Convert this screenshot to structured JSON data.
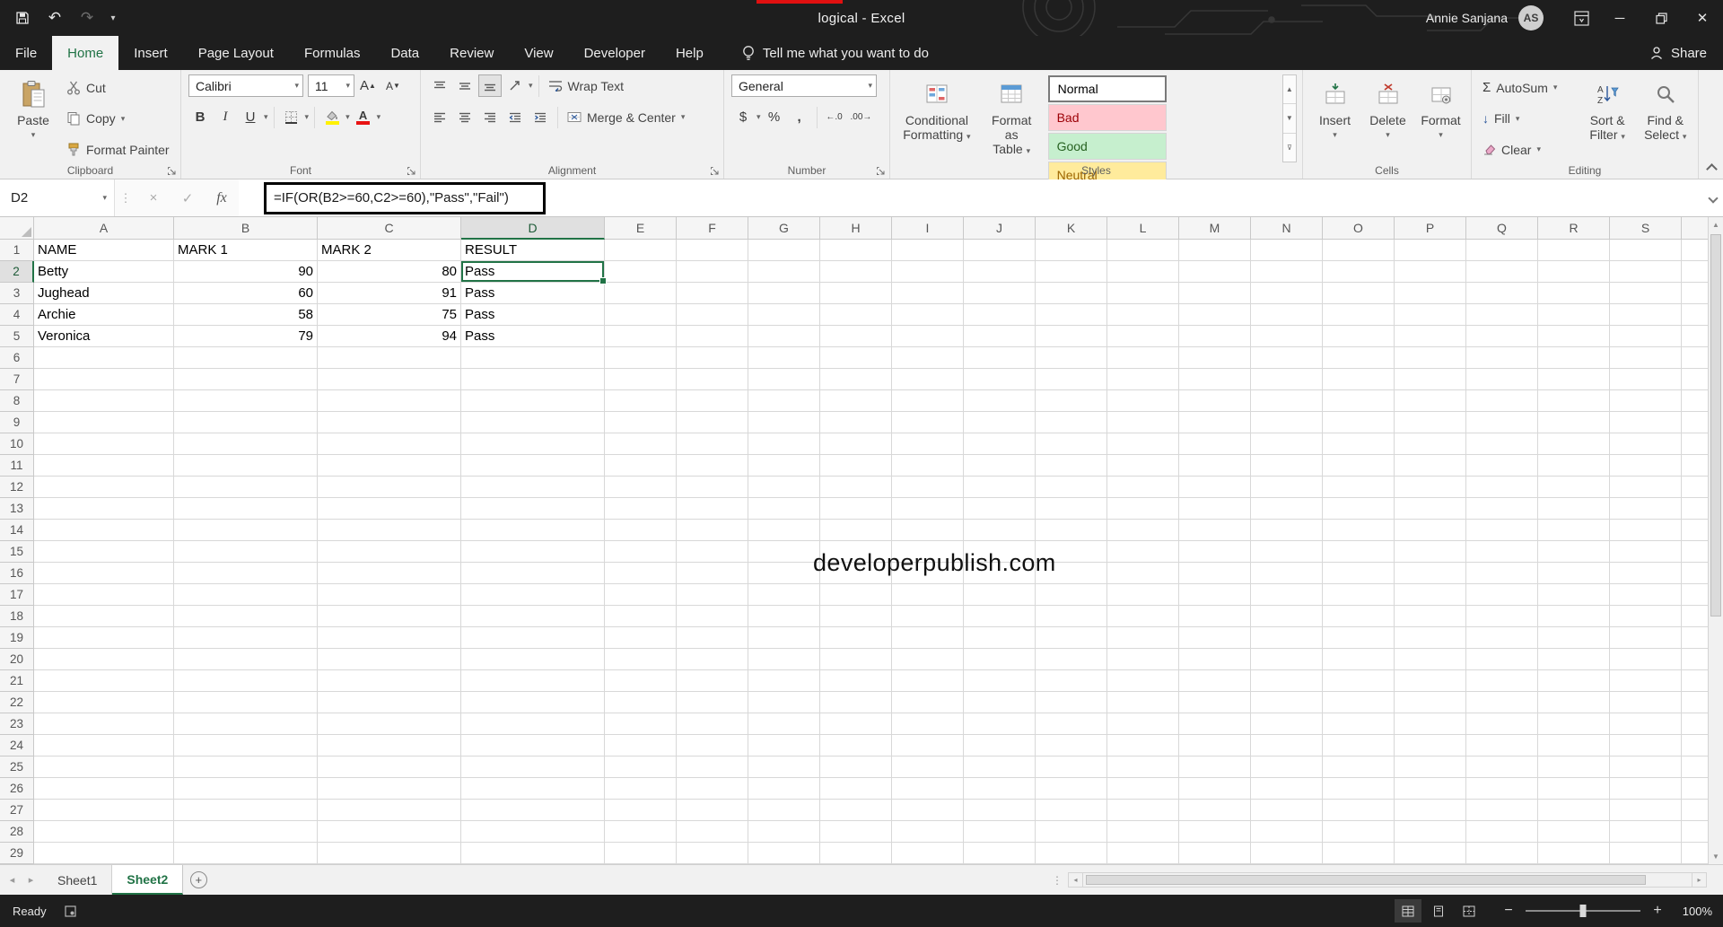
{
  "title_bar": {
    "title": "logical  -  Excel",
    "user_name": "Annie Sanjana",
    "user_initials": "AS"
  },
  "ribbon_tabs": {
    "items": [
      {
        "label": "File"
      },
      {
        "label": "Home"
      },
      {
        "label": "Insert"
      },
      {
        "label": "Page Layout"
      },
      {
        "label": "Formulas"
      },
      {
        "label": "Data"
      },
      {
        "label": "Review"
      },
      {
        "label": "View"
      },
      {
        "label": "Developer"
      },
      {
        "label": "Help"
      }
    ],
    "active": "Home",
    "tell_me": "Tell me what you want to do",
    "share": "Share"
  },
  "ribbon": {
    "clipboard": {
      "label": "Clipboard",
      "paste": "Paste",
      "cut": "Cut",
      "copy": "Copy",
      "format_painter": "Format Painter"
    },
    "font": {
      "label": "Font",
      "family": "Calibri",
      "size": "11"
    },
    "alignment": {
      "label": "Alignment",
      "wrap_text": "Wrap Text",
      "merge_center": "Merge & Center"
    },
    "number": {
      "label": "Number",
      "format": "General"
    },
    "styles": {
      "label": "Styles",
      "conditional_line1": "Conditional",
      "conditional_line2": "Formatting",
      "format_table_line1": "Format as",
      "format_table_line2": "Table",
      "cell_styles": [
        {
          "name": "Normal",
          "bg": "#FFFFFF",
          "fg": "#000000"
        },
        {
          "name": "Bad",
          "bg": "#FFC7CE",
          "fg": "#9C0006"
        },
        {
          "name": "Good",
          "bg": "#C6EFCE",
          "fg": "#276221"
        },
        {
          "name": "Neutral",
          "bg": "#FFEB9C",
          "fg": "#9C6500"
        }
      ]
    },
    "cells": {
      "label": "Cells",
      "insert": "Insert",
      "delete": "Delete",
      "format": "Format"
    },
    "editing": {
      "label": "Editing",
      "autosum": "AutoSum",
      "fill": "Fill",
      "clear": "Clear",
      "sort_line1": "Sort &",
      "sort_line2": "Filter",
      "find_line1": "Find &",
      "find_line2": "Select"
    }
  },
  "icons": {
    "bold_icon": "B",
    "italic_icon": "I",
    "underline_icon": "U",
    "accounting_icon": "$",
    "percent_icon": "%",
    "comma_icon": ",",
    "autosum_icon": "Σ",
    "fill_icon": "↓",
    "fx_icon": "fx",
    "cancel_icon": "×",
    "enter_icon": "✓"
  },
  "formula_bar": {
    "name_box": "D2",
    "formula": "=IF(OR(B2>=60,C2>=60),\"Pass\",\"Fail\")"
  },
  "sheet": {
    "columns": [
      "A",
      "B",
      "C",
      "D",
      "E",
      "F",
      "G",
      "H",
      "I",
      "J",
      "K",
      "L",
      "M",
      "N",
      "O",
      "P",
      "Q",
      "R",
      "S"
    ],
    "row_count": 29,
    "selection": {
      "cell": "D2",
      "col": "D",
      "row": 2
    },
    "cells": [
      {
        "r": 1,
        "c": "A",
        "t": "NAME"
      },
      {
        "r": 1,
        "c": "B",
        "t": "MARK 1"
      },
      {
        "r": 1,
        "c": "C",
        "t": "MARK 2"
      },
      {
        "r": 1,
        "c": "D",
        "t": "RESULT"
      },
      {
        "r": 2,
        "c": "A",
        "t": "Betty"
      },
      {
        "r": 2,
        "c": "B",
        "t": "90"
      },
      {
        "r": 2,
        "c": "C",
        "t": "80"
      },
      {
        "r": 2,
        "c": "D",
        "t": "Pass"
      },
      {
        "r": 3,
        "c": "A",
        "t": "Jughead"
      },
      {
        "r": 3,
        "c": "B",
        "t": "60"
      },
      {
        "r": 3,
        "c": "C",
        "t": "91"
      },
      {
        "r": 3,
        "c": "D",
        "t": "Pass"
      },
      {
        "r": 4,
        "c": "A",
        "t": "Archie"
      },
      {
        "r": 4,
        "c": "B",
        "t": "58"
      },
      {
        "r": 4,
        "c": "C",
        "t": "75"
      },
      {
        "r": 4,
        "c": "D",
        "t": "Pass"
      },
      {
        "r": 5,
        "c": "A",
        "t": "Veronica"
      },
      {
        "r": 5,
        "c": "B",
        "t": "79"
      },
      {
        "r": 5,
        "c": "C",
        "t": "94"
      },
      {
        "r": 5,
        "c": "D",
        "t": "Pass"
      }
    ],
    "watermark": "developerpublish.com"
  },
  "sheet_bar": {
    "tabs": [
      {
        "name": "Sheet1",
        "active": false
      },
      {
        "name": "Sheet2",
        "active": true
      }
    ]
  },
  "status_bar": {
    "ready": "Ready",
    "zoom": "100%"
  },
  "colors": {
    "accent_green": "#217346",
    "titlebar": "#1E1E1E",
    "annotation_red": "#E01010",
    "annotation_black": "#000000",
    "fill_color_swatch": "#FFF100",
    "font_color_swatch": "#E81313"
  }
}
